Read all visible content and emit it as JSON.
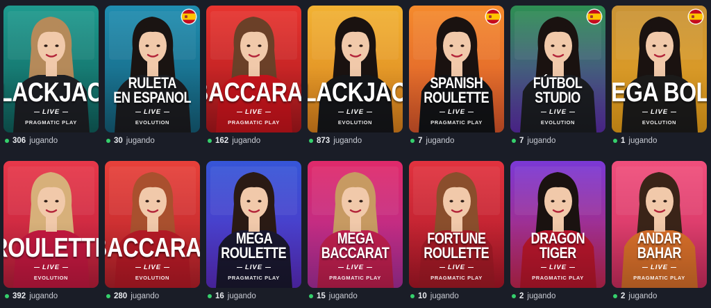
{
  "games": [
    {
      "title": [
        "Blackjack"
      ],
      "live": "LIVE",
      "provider": "PRAGMATIC PLAY",
      "players": "306",
      "players_label": "jugando",
      "flag": false,
      "bg": [
        "#1e9a8e",
        "#0f5e5a"
      ],
      "hair": "#b58a5a",
      "outfit": "#1d1f24"
    },
    {
      "title": [
        "Ruleta",
        "en Espanol"
      ],
      "live": "LIVE",
      "provider": "EVOLUTION",
      "players": "30",
      "players_label": "jugando",
      "flag": true,
      "bg": [
        "#1f8db0",
        "#145d77"
      ],
      "hair": "#1a1412",
      "outfit": "#1b1c20"
    },
    {
      "title": [
        "Baccarat"
      ],
      "live": "LIVE",
      "provider": "PRAGMATIC PLAY",
      "players": "162",
      "players_label": "jugando",
      "flag": false,
      "bg": [
        "#e8342f",
        "#a8161c"
      ],
      "hair": "#6b4028",
      "outfit": "#c8141c"
    },
    {
      "title": [
        "Blackjack"
      ],
      "live": "LIVE",
      "provider": "EVOLUTION",
      "players": "873",
      "players_label": "jugando",
      "flag": false,
      "bg": [
        "#f2b233",
        "#d9801c"
      ],
      "hair": "#1a1210",
      "outfit": "#151619"
    },
    {
      "title": [
        "Spanish",
        "Roulette"
      ],
      "live": "LIVE",
      "provider": "PRAGMATIC PLAY",
      "players": "7",
      "players_label": "jugando",
      "flag": true,
      "bg": [
        "#f58a2c",
        "#d8552a"
      ],
      "hair": "#1a1210",
      "outfit": "#121316"
    },
    {
      "title": [
        "Fútbol",
        "Studio"
      ],
      "live": "LIVE",
      "provider": "EVOLUTION",
      "players": "7",
      "players_label": "jugando",
      "flag": true,
      "bg": [
        "#2d8f52",
        "#5b2ca8"
      ],
      "hair": "#1a1210",
      "outfit": "#1b1d22"
    },
    {
      "title": [
        "Mega Bola"
      ],
      "live": "LIVE",
      "provider": "EVOLUTION",
      "players": "1",
      "players_label": "jugando",
      "flag": true,
      "bg": [
        "#c99336",
        "#e9a019"
      ],
      "hair": "#1a1210",
      "outfit": "#1c1b1a"
    },
    {
      "title": [
        "Roulette"
      ],
      "live": "LIVE",
      "provider": "EVOLUTION",
      "players": "392",
      "players_label": "jugando",
      "flag": false,
      "bg": [
        "#e8384a",
        "#b81d3a"
      ],
      "hair": "#d7b07a",
      "outfit": "#c41840"
    },
    {
      "title": [
        "Baccarat"
      ],
      "live": "LIVE",
      "provider": "EVOLUTION",
      "players": "280",
      "players_label": "jugando",
      "flag": false,
      "bg": [
        "#e8413a",
        "#b31f29"
      ],
      "hair": "#a9502e",
      "outfit": "#b71a26"
    },
    {
      "title": [
        "Mega",
        "Roulette"
      ],
      "live": "LIVE",
      "provider": "PRAGMATIC PLAY",
      "players": "16",
      "players_label": "jugando",
      "flag": false,
      "bg": [
        "#3656d8",
        "#5a2bc0"
      ],
      "hair": "#2a1a14",
      "outfit": "#1a1830"
    },
    {
      "title": [
        "Mega",
        "Baccarat"
      ],
      "live": "LIVE",
      "provider": "PRAGMATIC PLAY",
      "players": "15",
      "players_label": "jugando",
      "flag": false,
      "bg": [
        "#e02a6a",
        "#a72e9b"
      ],
      "hair": "#c79a62",
      "outfit": "#c01f4f"
    },
    {
      "title": [
        "Fortune",
        "Roulette"
      ],
      "live": "LIVE",
      "provider": "PRAGMATIC PLAY",
      "players": "10",
      "players_label": "jugando",
      "flag": false,
      "bg": [
        "#e2333f",
        "#a81626"
      ],
      "hair": "#8a4e2c",
      "outfit": "#a51a26"
    },
    {
      "title": [
        "Dragon",
        "Tiger"
      ],
      "live": "LIVE",
      "provider": "PRAGMATIC PLAY",
      "players": "2",
      "players_label": "jugando",
      "flag": false,
      "bg": [
        "#7a39d6",
        "#c3264f"
      ],
      "hair": "#1a1210",
      "outfit": "#b8162c"
    },
    {
      "title": [
        "Andar",
        "Bahar"
      ],
      "live": "LIVE",
      "provider": "PRAGMATIC PLAY",
      "players": "2",
      "players_label": "jugando",
      "flag": false,
      "bg": [
        "#f04f7c",
        "#ca2c5d"
      ],
      "hair": "#3a2418",
      "outfit": "#d86f2a"
    }
  ]
}
